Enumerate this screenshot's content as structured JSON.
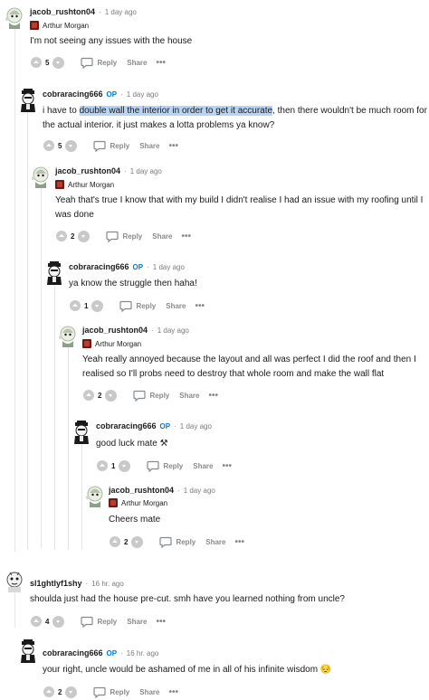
{
  "actions": {
    "reply_label": "Reply",
    "share_label": "Share",
    "more_label": "•••"
  },
  "comments": [
    {
      "username": "jacob_rushton04",
      "op": "",
      "time": "1 day ago",
      "flair": "Arthur Morgan",
      "text_before": "I'm not seeing any issues with the house",
      "highlight": "",
      "text_after": "",
      "score": "5"
    },
    {
      "username": "cobraracing666",
      "op": "OP",
      "time": "1 day ago",
      "flair": "",
      "text_before": "i have to ",
      "highlight": "double wall the interior in order to get it accurate",
      "text_after": ", then there wouldn't be much room for the actual interior. it just makes a lotta problems ya know?",
      "score": "5"
    },
    {
      "username": "jacob_rushton04",
      "op": "",
      "time": "1 day ago",
      "flair": "Arthur Morgan",
      "text_before": "Yeah that's true I know that with my build I didn't realise I had an issue with my roofing until I was done",
      "highlight": "",
      "text_after": "",
      "score": "2"
    },
    {
      "username": "cobraracing666",
      "op": "OP",
      "time": "1 day ago",
      "flair": "",
      "text_before": "ya know the struggle then haha!",
      "highlight": "",
      "text_after": "",
      "score": "1"
    },
    {
      "username": "jacob_rushton04",
      "op": "",
      "time": "1 day ago",
      "flair": "Arthur Morgan",
      "text_before": "Yeah really annoyed because the layout and all was perfect I did the roof and then I realised so I'll probs need to destroy that whole room and make the wall flat",
      "highlight": "",
      "text_after": "",
      "score": "2"
    },
    {
      "username": "cobraracing666",
      "op": "OP",
      "time": "1 day ago",
      "flair": "",
      "text_before": "good luck mate ⚒",
      "highlight": "",
      "text_after": "",
      "score": "1"
    },
    {
      "username": "jacob_rushton04",
      "op": "",
      "time": "1 day ago",
      "flair": "Arthur Morgan",
      "text_before": "Cheers mate",
      "highlight": "",
      "text_after": "",
      "score": "2"
    },
    {
      "username": "sl1ghtlyf1shy",
      "op": "",
      "time": "16 hr. ago",
      "flair": "",
      "text_before": "shoulda just had the house pre-cut. smh have you learned nothing from uncle?",
      "highlight": "",
      "text_after": "",
      "score": "4"
    },
    {
      "username": "cobraracing666",
      "op": "OP",
      "time": "16 hr. ago",
      "flair": "",
      "text_before": "your right, uncle would be ashamed of me in all of his infinite wisdom 😔",
      "highlight": "",
      "text_after": "",
      "score": "2"
    }
  ]
}
